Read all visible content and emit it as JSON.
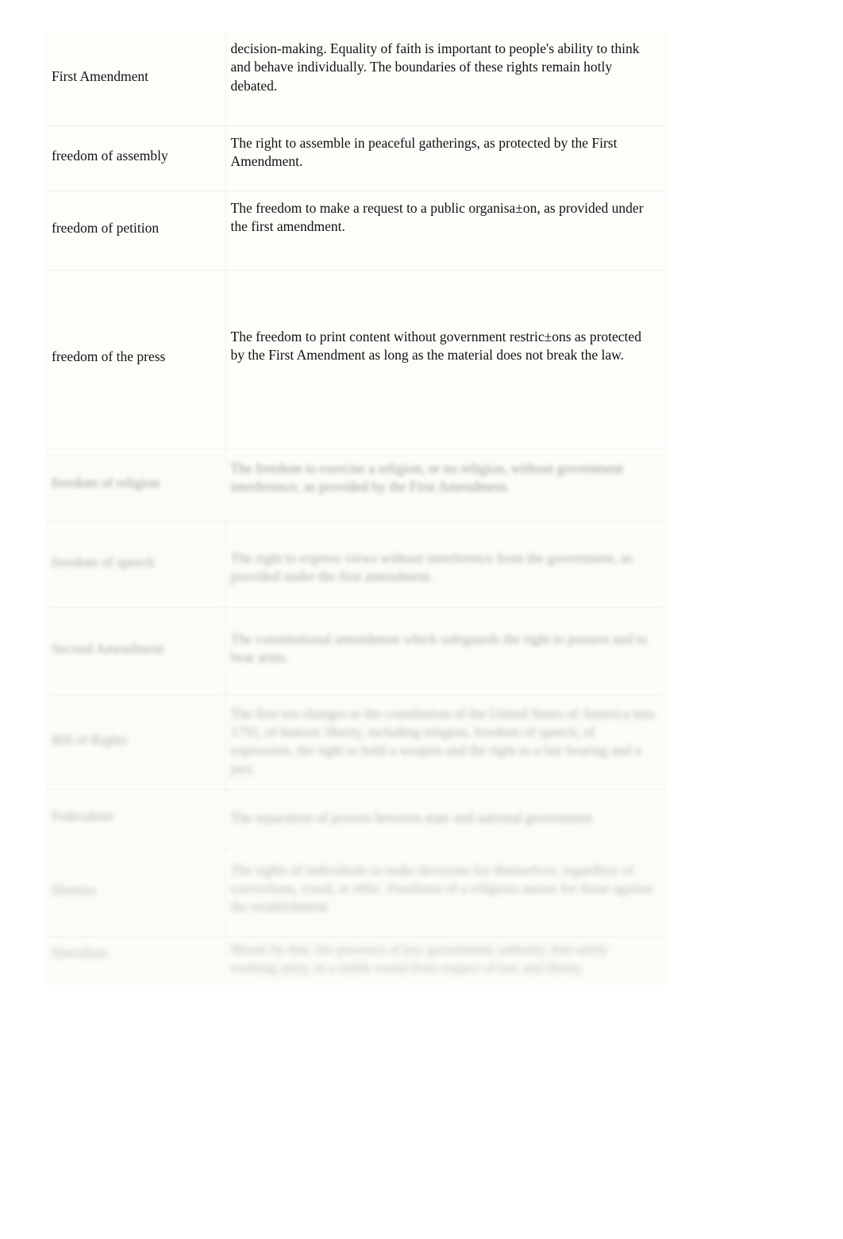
{
  "document": {
    "type": "glossary-table",
    "background_color": "#ffffff",
    "table_background_color": "#fdfdfa",
    "text_color": "#111111",
    "divider_color": "#f0efe9"
  },
  "table": {
    "columns": [
      "term",
      "definition"
    ],
    "rows": [
      {
        "term": "First Amendment",
        "definition": "decision-making. Equality of faith is important to people's ability to think and behave individually. The boundaries of these rights remain hotly debated.",
        "legibility": "sharp"
      },
      {
        "term": "freedom of assembly",
        "definition": "The right to assemble in peaceful gatherings, as protected by the First Amendment.",
        "legibility": "sharp"
      },
      {
        "term": "freedom of petition",
        "definition": "The freedom to make a request to a public organisa±on, as provided under the first amendment.",
        "legibility": "sharp"
      },
      {
        "term": "freedom of the press",
        "definition": "The freedom to print content without government restric±ons as protected by the First Amendment as long as the material does not break the law.",
        "legibility": "sharp"
      },
      {
        "term": "freedom of religion",
        "definition": "The freedom to exercise a religion, or no religion, without government interference, as provided by the First Amendment.",
        "legibility": "blurred"
      },
      {
        "term": "freedom of speech",
        "definition": "The right to express views without interference from the government, as provided under the first amendment.",
        "legibility": "blurred"
      },
      {
        "term": "Second Amendment",
        "definition": "The constitutional amendment which safeguards the right to possess and to bear arms.",
        "legibility": "blurred"
      },
      {
        "term": "Bill of Rights",
        "definition": "The first ten changes to the constitution of the United States of America into 1791, of historic liberty, including religion, freedom of speech, of expression, the right to hold a weapon and the right to a fair hearing and a jury.",
        "legibility": "blurred"
      },
      {
        "term": "Federalism",
        "definition": "The separation of powers between state and national government.",
        "legibility": "blurred"
      },
      {
        "term": "liberties",
        "definition": "The rights of individuals to make decisions for themselves, regardless of convictions, creed, or ethic. Freedoms of a religious nature for those against the establishment.",
        "legibility": "blurred"
      },
      {
        "term": "liberalism",
        "definition": "Means by that, the presence of key government authority that safely working unity, in a stable world from respect of law and liberty",
        "legibility": "blurred"
      }
    ]
  }
}
